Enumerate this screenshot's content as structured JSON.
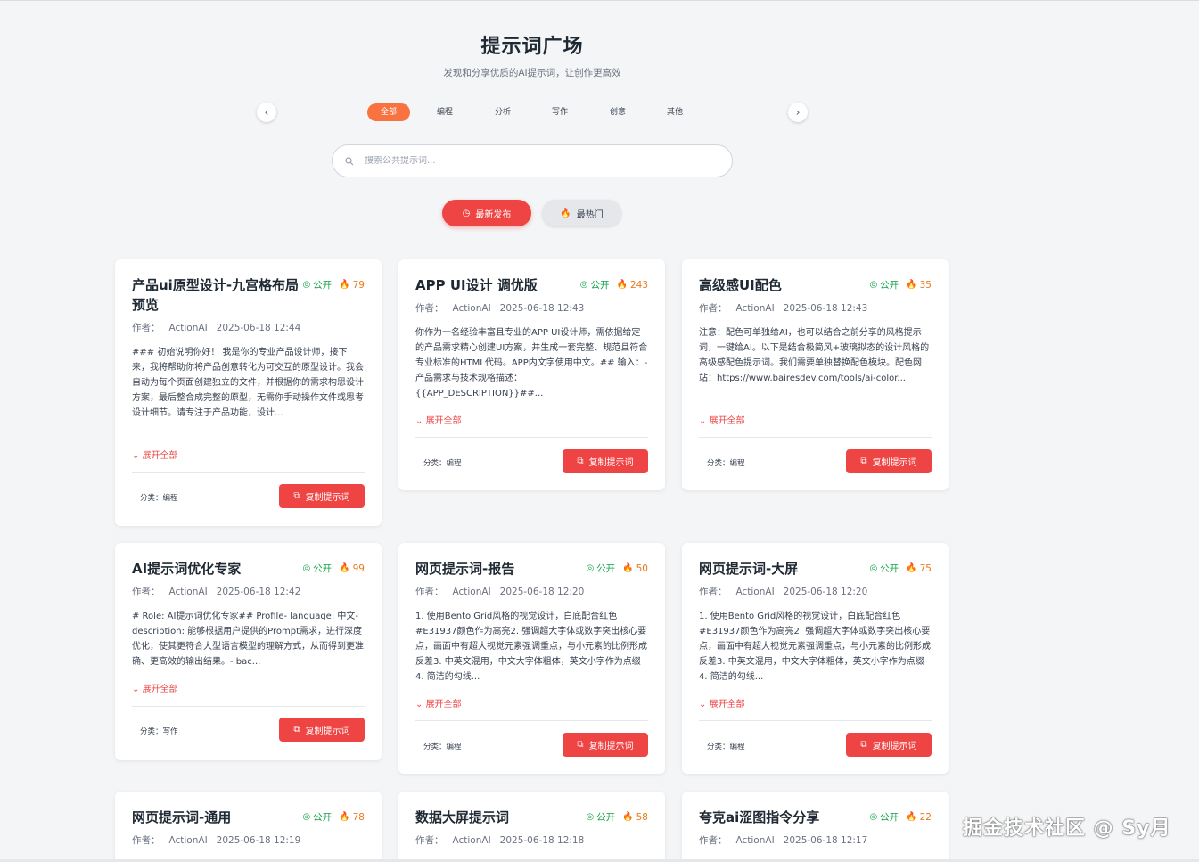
{
  "header": {
    "title": "提示词广场",
    "subtitle": "发现和分享优质的AI提示词，让创作更高效"
  },
  "categories": [
    "全部",
    "编程",
    "分析",
    "写作",
    "创意",
    "其他"
  ],
  "active_category": "全部",
  "search": {
    "placeholder": "搜索公共提示词..."
  },
  "sort": {
    "latest_label": "最新发布",
    "hot_label": "最热门",
    "active": "最新发布"
  },
  "card_labels": {
    "public": "公开",
    "author_prefix": "作者：",
    "expand": "展开全部",
    "category_prefix": "分类：",
    "copy": "复制提示词"
  },
  "cards": [
    {
      "title": "产品ui原型设计-九宫格布局预览",
      "heat": "79",
      "author": "ActionAI",
      "time": "2025-06-18 12:44",
      "preview": "### 初始说明你好！ 我是你的专业产品设计师，接下来，我将帮助你将产品创意转化为可交互的原型设计。我会自动为每个页面创建独立的文件，并根据你的需求构思设计方案，最后整合成完整的原型，无需你手动操作文件或思考设计细节。请专注于产品功能，设计...",
      "category": "编程"
    },
    {
      "title": "APP UI设计 调优版",
      "heat": "243",
      "author": "ActionAI",
      "time": "2025-06-18 12:43",
      "preview": "你作为一名经验丰富且专业的APP UI设计师，需依据给定的产品需求精心创建UI方案，并生成一套完整、规范且符合专业标准的HTML代码。APP内文字使用中文。## 输入：- 产品需求与技术规格描述：{{APP_DESCRIPTION}}##...",
      "category": "编程"
    },
    {
      "title": "高级感UI配色",
      "heat": "35",
      "author": "ActionAI",
      "time": "2025-06-18 12:43",
      "preview": "注意：配色可单独给AI，也可以结合之前分享的风格提示词，一键给AI。以下是结合极简风+玻璃拟态的设计风格的高级感配色提示词。我们需要单独替换配色模块。配色网站：https://www.bairesdev.com/tools/ai-color...",
      "category": "编程"
    },
    {
      "title": "AI提示词优化专家",
      "heat": "99",
      "author": "ActionAI",
      "time": "2025-06-18 12:42",
      "preview": "# Role: AI提示词优化专家## Profile- language: 中文- description: 能够根据用户提供的Prompt需求，进行深度优化，使其更符合大型语言模型的理解方式，从而得到更准确、更高效的输出结果。- bac...",
      "category": "写作"
    },
    {
      "title": "网页提示词-报告",
      "heat": "50",
      "author": "ActionAI",
      "time": "2025-06-18 12:20",
      "preview": "1. 使用Bento Grid风格的视觉设计，白底配合红色#E31937颜色作为高亮2. 强调超大字体或数字突出核心要点，画面中有超大视觉元素强调重点，与小元素的比例形成反差3. 中英文混用，中文大字体粗体，英文小字作为点缀4. 简洁的勾线...",
      "category": "编程"
    },
    {
      "title": "网页提示词-大屏",
      "heat": "75",
      "author": "ActionAI",
      "time": "2025-06-18 12:20",
      "preview": "1. 使用Bento Grid风格的视觉设计，白底配合红色#E31937颜色作为高亮2. 强调超大字体或数字突出核心要点，画面中有超大视觉元素强调重点，与小元素的比例形成反差3. 中英文混用，中文大字体粗体，英文小字作为点缀4. 简洁的勾线...",
      "category": "编程"
    },
    {
      "title": "网页提示词-通用",
      "heat": "78",
      "author": "ActionAI",
      "time": "2025-06-18 12:19"
    },
    {
      "title": "数据大屏提示词",
      "heat": "58",
      "author": "ActionAI",
      "time": "2025-06-18 12:18"
    },
    {
      "title": "夸克ai涩图指令分享",
      "heat": "22",
      "author": "ActionAI",
      "time": "2025-06-18 12:17"
    }
  ],
  "watermark": "掘金技术社区 @ Sy月",
  "colors": {
    "accent_red": "#ef4444",
    "category_active": "#f97340",
    "public_green": "#16a34a",
    "heat_orange": "#ea7a1a"
  }
}
